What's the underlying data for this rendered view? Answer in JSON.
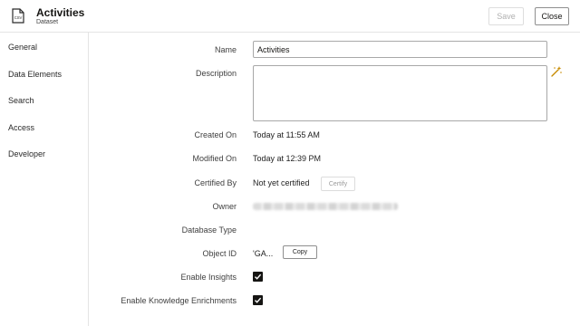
{
  "header": {
    "title": "Activities",
    "subtitle": "Dataset",
    "icon": "csv-file-icon",
    "save_label": "Save",
    "close_label": "Close"
  },
  "sidebar": {
    "items": [
      {
        "label": "General",
        "selected": true
      },
      {
        "label": "Data Elements"
      },
      {
        "label": "Search"
      },
      {
        "label": "Access"
      },
      {
        "label": "Developer"
      }
    ]
  },
  "form": {
    "name": {
      "label": "Name",
      "value": "Activities"
    },
    "description": {
      "label": "Description",
      "value": ""
    },
    "created_on": {
      "label": "Created On",
      "value": "Today at 11:55 AM"
    },
    "modified_on": {
      "label": "Modified On",
      "value": "Today at 12:39 PM"
    },
    "certified_by": {
      "label": "Certified By",
      "value": "Not yet certified",
      "button": "Certify"
    },
    "owner": {
      "label": "Owner"
    },
    "database_type": {
      "label": "Database Type",
      "value": ""
    },
    "object_id": {
      "label": "Object ID",
      "value": "'GA...",
      "button": "Copy"
    },
    "enable_insights": {
      "label": "Enable Insights",
      "checked": true
    },
    "enable_knowledge": {
      "label": "Enable Knowledge Enrichments",
      "checked": true
    }
  },
  "colors": {
    "accent": "#c78a00",
    "checkbox": "#161513"
  }
}
